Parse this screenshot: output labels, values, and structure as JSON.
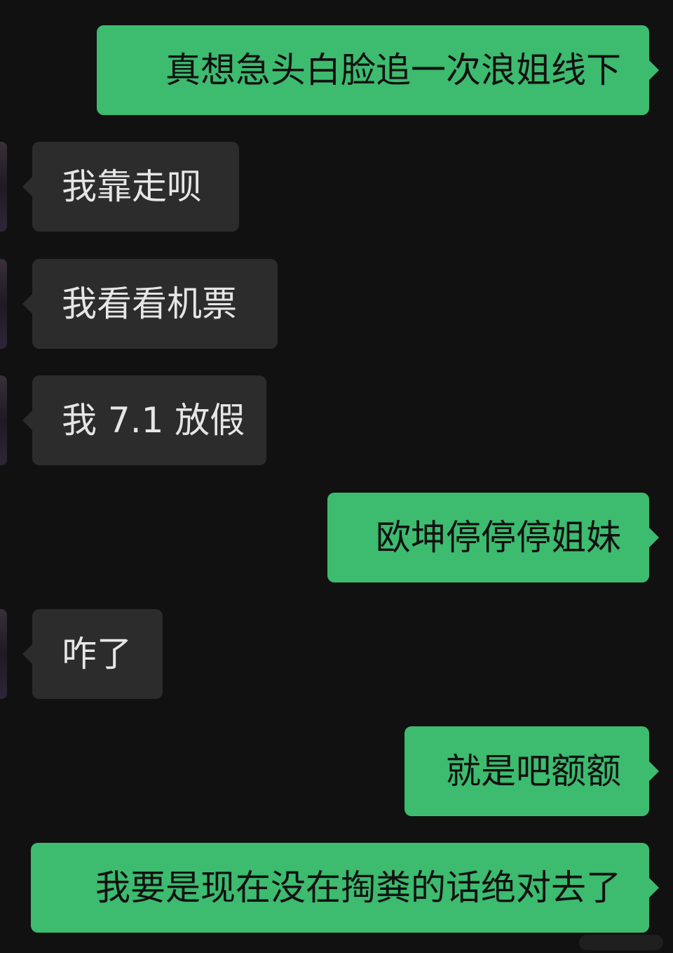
{
  "conversation": {
    "messages": [
      {
        "side": "out",
        "text": "真想急头白脸追一次浪姐线下"
      },
      {
        "side": "in",
        "text": "我靠走呗"
      },
      {
        "side": "in",
        "text": "我看看机票"
      },
      {
        "side": "in",
        "text": "我 7.1 放假"
      },
      {
        "side": "out",
        "text": "欧坤停停停姐妹"
      },
      {
        "side": "in",
        "text": "咋了"
      },
      {
        "side": "out",
        "text": "就是吧额额"
      },
      {
        "side": "out",
        "text": "我要是现在没在掏粪的话绝对去了"
      }
    ]
  },
  "colors": {
    "background": "#111111",
    "outgoing_bubble": "#3dbb6f",
    "incoming_bubble": "#2c2c2c",
    "outgoing_text": "#111111",
    "incoming_text": "#e6e6e6"
  }
}
